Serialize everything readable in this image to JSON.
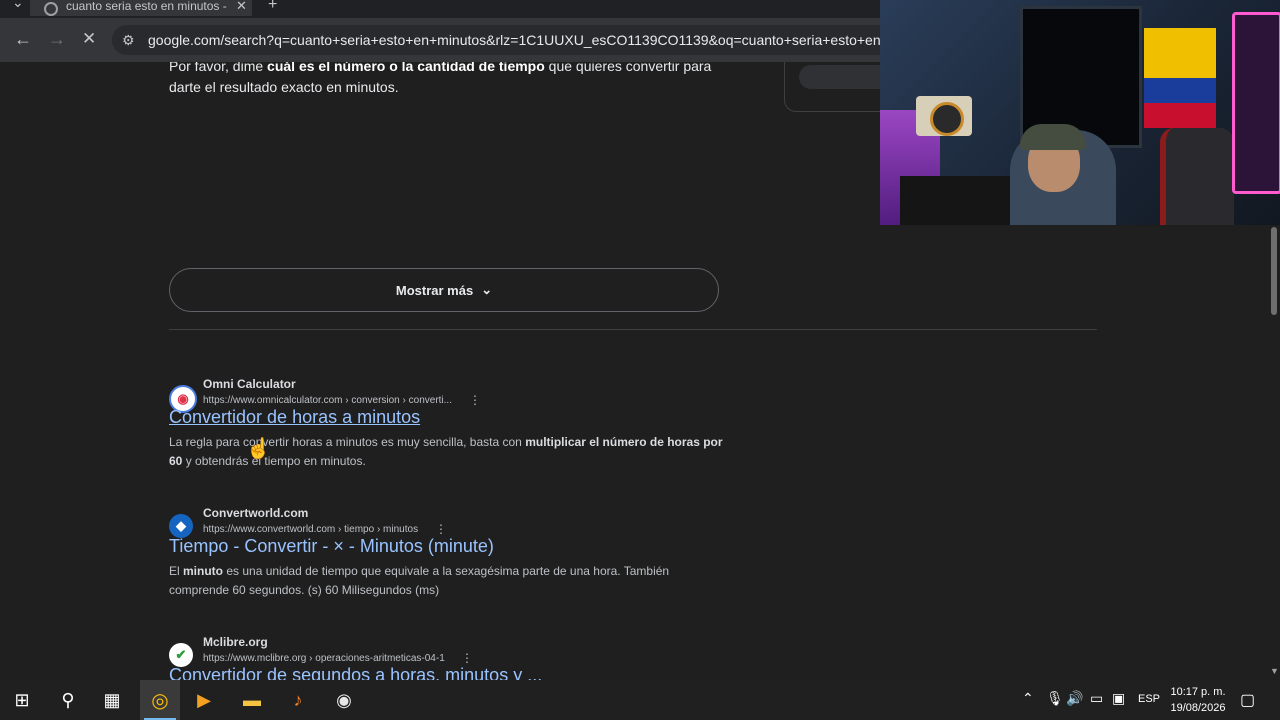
{
  "browser": {
    "tab_title": "cuanto seria esto en minutos -",
    "url": "google.com/search?q=cuanto+seria+esto+en+minutos&rlz=1C1UUXU_esCO1139CO1139&oq=cuanto+seria+esto+en+min&"
  },
  "answer": {
    "pre": "Por favor, dime ",
    "bold": "cuál es el número o la cantidad de tiempo",
    "post": " que quieres convertir para darte el resultado exacto en minutos."
  },
  "show_more_label": "Mostrar más",
  "results": [
    {
      "site": "Omni Calculator",
      "url": "https://www.omnicalculator.com › conversion › converti...",
      "title": "Convertidor de horas a minutos",
      "snippet_pre": "La regla para convertir horas a minutos es muy sencilla, basta con ",
      "snippet_bold": "multiplicar el número de horas por 60",
      "snippet_post": " y obtendrás el tiempo en minutos."
    },
    {
      "site": "Convertworld.com",
      "url": "https://www.convertworld.com › tiempo › minutos",
      "title": "Tiempo - Convertir - × - Minutos (minute)",
      "snippet_pre": "El ",
      "snippet_bold": "minuto",
      "snippet_post": " es una unidad de tiempo que equivale a la sexagésima parte de una hora. También comprende 60 segundos. (s) 60 Milisegundos (ms)"
    },
    {
      "site": "Mclibre.org",
      "url": "https://www.mclibre.org › operaciones-aritmeticas-04-1",
      "title": "Convertidor de segundos a horas, minutos y ..."
    }
  ],
  "taskbar": {
    "language": "ESP",
    "time": "10:17 p. m.",
    "date": "19/08/2026"
  },
  "colors": {
    "link": "#99c3ff",
    "background": "#1f1f1f",
    "taskbar": "#202020"
  },
  "icons": [
    "tab-close-icon",
    "new-tab-icon",
    "back-icon",
    "forward-icon",
    "stop-icon",
    "site-info-icon",
    "chevron-down-icon",
    "more-vert-icon",
    "windows-start-icon",
    "search-icon",
    "task-view-icon",
    "chrome-icon",
    "media-icon",
    "file-explorer-icon",
    "fl-studio-icon",
    "obs-icon",
    "chevron-up-icon",
    "microphone-icon",
    "volume-icon",
    "battery-icon",
    "network-icon",
    "notification-icon"
  ]
}
